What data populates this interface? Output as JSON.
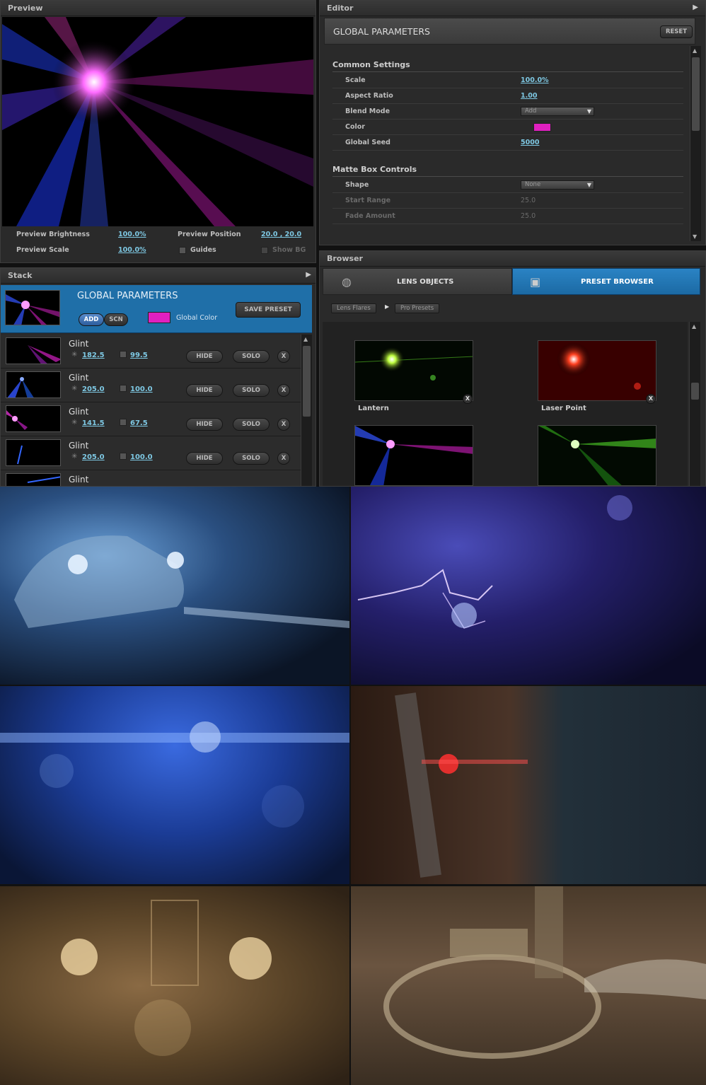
{
  "preview": {
    "title": "Preview",
    "brightness_label": "Preview Brightness",
    "brightness_value": "100.0%",
    "position_label": "Preview Position",
    "position_value": "20.0 , 20.0",
    "scale_label": "Preview Scale",
    "scale_value": "100.0%",
    "guides_label": "Guides",
    "show_bg_label": "Show BG"
  },
  "stack": {
    "title": "Stack",
    "header_title": "GLOBAL PARAMETERS",
    "add_label": "ADD",
    "scn_label": "SCN",
    "global_color_label": "Global Color",
    "save_preset_label": "SAVE PRESET",
    "hide_label": "HIDE",
    "solo_label": "SOLO",
    "x_label": "X",
    "rows": [
      {
        "name": "Glint",
        "brightness": "182.5",
        "scale": "99.5"
      },
      {
        "name": "Glint",
        "brightness": "205.0",
        "scale": "100.0"
      },
      {
        "name": "Glint",
        "brightness": "141.5",
        "scale": "67.5"
      },
      {
        "name": "Glint",
        "brightness": "205.0",
        "scale": "100.0"
      },
      {
        "name": "Glint"
      }
    ]
  },
  "editor": {
    "title": "Editor",
    "header_title": "GLOBAL PARAMETERS",
    "reset_label": "RESET",
    "common_title": "Common Settings",
    "common": [
      {
        "label": "Scale",
        "value": "100.0%"
      },
      {
        "label": "Aspect Ratio",
        "value": "1.00"
      },
      {
        "label": "Blend Mode",
        "value": "Add"
      },
      {
        "label": "Color",
        "value": ""
      },
      {
        "label": "Global Seed",
        "value": "5000"
      }
    ],
    "matte_title": "Matte Box Controls",
    "matte": [
      {
        "label": "Shape",
        "value": "None"
      },
      {
        "label": "Start Range",
        "value": "25.0"
      },
      {
        "label": "Fade Amount",
        "value": "25.0"
      }
    ]
  },
  "browser": {
    "title": "Browser",
    "tab_lens": "LENS OBJECTS",
    "tab_preset": "PRESET BROWSER",
    "crumb_1": "Lens Flares",
    "crumb_2": "Pro Presets",
    "presets": [
      {
        "label": "Lantern"
      },
      {
        "label": "Laser Point"
      }
    ]
  },
  "colors": {
    "accent": "#1f6fa8",
    "global_color": "#e020c0",
    "link": "#7ec8e3"
  }
}
